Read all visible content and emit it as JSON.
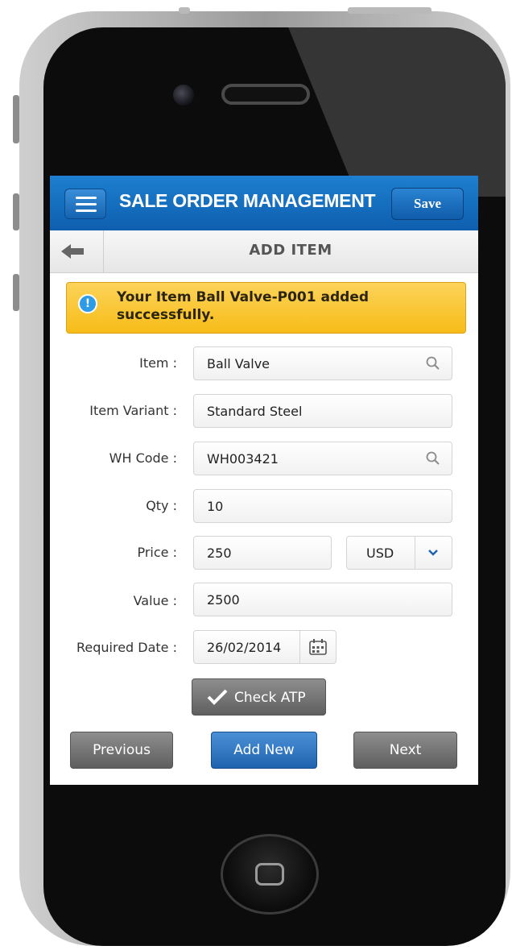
{
  "app": {
    "title": "SALE ORDER MANAGEMENT",
    "save_label": "Save"
  },
  "subheader": {
    "title": "ADD ITEM"
  },
  "alert": {
    "message": "Your Item Ball Valve-P001 added successfully.",
    "icon": "info-icon"
  },
  "form": {
    "item_label": "Item :",
    "item_value": "Ball Valve",
    "variant_label": "Item Variant :",
    "variant_value": "Standard Steel",
    "wh_label": "WH Code :",
    "wh_value": "WH003421",
    "qty_label": "Qty :",
    "qty_value": "10",
    "price_label": "Price :",
    "price_value": "250",
    "currency_value": "USD",
    "value_label": "Value :",
    "value_value": "2500",
    "date_label": "Required Date :",
    "date_value": "26/02/2014"
  },
  "buttons": {
    "check_atp": "Check ATP",
    "previous": "Previous",
    "add_new": "Add New",
    "next": "Next"
  },
  "colors": {
    "appbar": "#1167b5",
    "alert": "#f9c52a",
    "primary_button": "#2f73bd",
    "secondary_button": "#707070"
  }
}
